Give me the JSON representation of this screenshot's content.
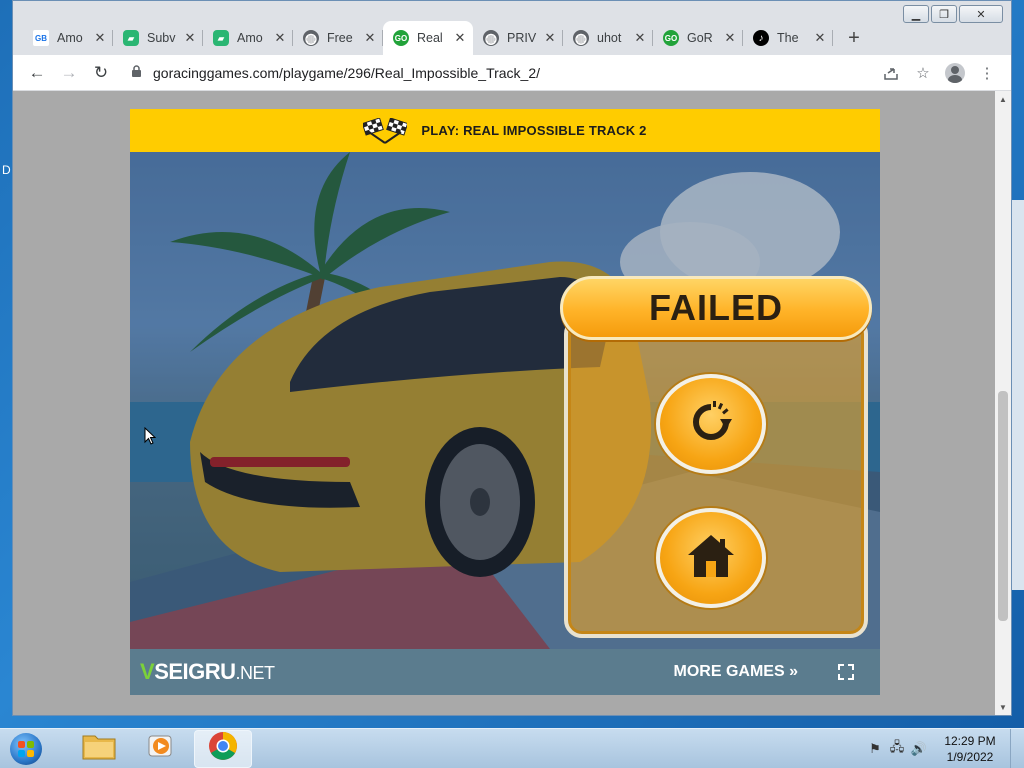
{
  "browser": {
    "tabs": [
      {
        "title": "Amo",
        "icon": "gb-icon",
        "color": "#ffffff",
        "active": false
      },
      {
        "title": "Subv",
        "icon": "gamepad-icon",
        "color": "#2bb673",
        "active": false
      },
      {
        "title": "Amo",
        "icon": "gamepad-icon",
        "color": "#2bb673",
        "active": false
      },
      {
        "title": "Free",
        "icon": "globe-icon",
        "color": "#5f6368",
        "active": false
      },
      {
        "title": "Real",
        "icon": "go-icon",
        "color": "#22a33a",
        "active": true
      },
      {
        "title": "PRIV",
        "icon": "globe-icon",
        "color": "#5f6368",
        "active": false
      },
      {
        "title": "uhot",
        "icon": "globe-icon",
        "color": "#5f6368",
        "active": false
      },
      {
        "title": "GoR",
        "icon": "go-icon",
        "color": "#22a33a",
        "active": false
      },
      {
        "title": "The",
        "icon": "tiktok-icon",
        "color": "#000000",
        "active": false
      }
    ],
    "url": "goracinggames.com/playgame/296/Real_Impossible_Track_2/"
  },
  "game": {
    "header_title": "PLAY:  REAL IMPOSSIBLE TRACK 2",
    "failed_label": "FAILED",
    "footer": {
      "brand_v": "V",
      "brand_main": "SEIGRU",
      "brand_net": ".NET",
      "more_games": "MORE GAMES »"
    }
  },
  "taskbar": {
    "time": "12:29 PM",
    "date": "1/9/2022"
  },
  "desktop": {
    "edge_label": "D"
  }
}
